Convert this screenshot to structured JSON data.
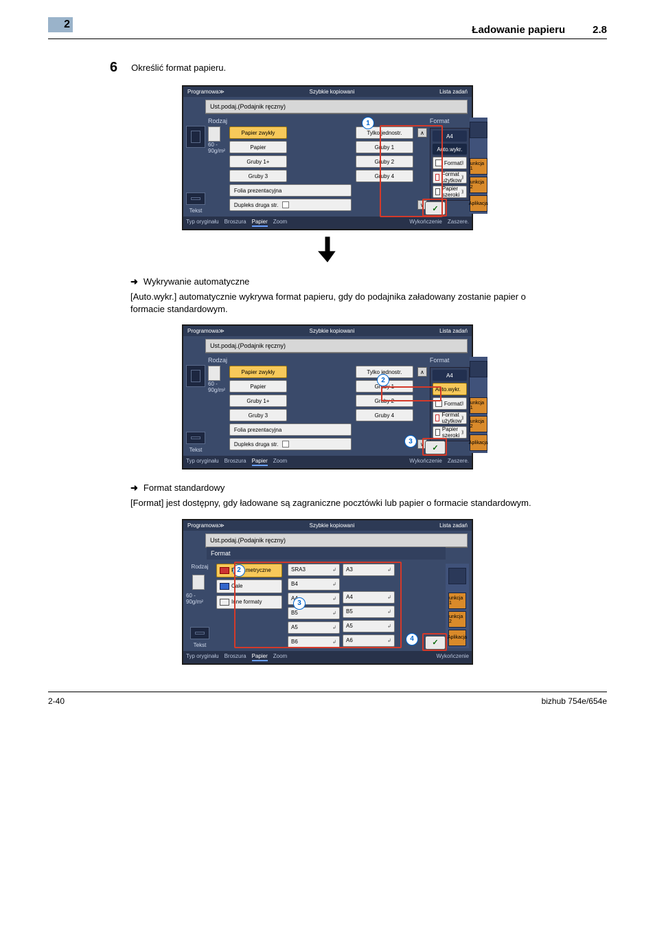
{
  "header": {
    "tab": "2",
    "title": "Ładowanie papieru",
    "section": "2.8"
  },
  "step": {
    "number": "6",
    "text": "Określić format papieru."
  },
  "sections": {
    "auto": {
      "heading": "Wykrywanie automatyczne",
      "desc": "[Auto.wykr.] automatycznie wykrywa format papieru, gdy do podajnika załadowany zostanie papier o formacie standardowym."
    },
    "std": {
      "heading": "Format standardowy",
      "desc": "[Format] jest dostępny, gdy ładowane są zagraniczne pocztówki lub papier o formacie standardowym."
    }
  },
  "shot_common": {
    "topbar_left": "Programowa≫",
    "topbar_mid": "Szybkie kopiowani",
    "topbar_right": "Lista zadań",
    "breadcrumb": "Ust.podaj.(Podajnik ręczny)",
    "rodzaj": "Rodzaj",
    "weight": "60 - 90g/m²",
    "format": "Format",
    "a4": "A4",
    "auto": "Auto.wykr.",
    "fmt": "Format",
    "fmt_uz": "Format użytkow",
    "fmt_sz": "Papier szeroki",
    "tekst": "Tekst",
    "bottom": {
      "typ": "Typ oryginału",
      "bro": "Broszura",
      "pap": "Papier",
      "zoom": "Zoom",
      "wyk": "Wykończenie",
      "zasz": "Zaszere."
    },
    "side": {
      "f1": "unkcja 1",
      "f2": "unkcja 2",
      "apl": "Aplikacja"
    },
    "paper_types_left": [
      "Papier zwykły",
      "Papier",
      "Gruby 1+",
      "Gruby 3",
      "Folia prezentacyjna",
      "Dupleks druga str."
    ],
    "paper_types_right": [
      "Tylko jednostr.",
      "Gruby 1",
      "Gruby 2",
      "Gruby 4"
    ]
  },
  "shot3": {
    "subhdr": "Format",
    "cats": [
      "Form.metryczne",
      "Cale",
      "Inne formaty"
    ],
    "col1": [
      "SRA3",
      "B4",
      "A4",
      "B5",
      "A5",
      "B6"
    ],
    "col2": [
      "A3",
      "",
      "A4",
      "B5",
      "A5",
      "A6"
    ]
  },
  "footer": {
    "left": "2-40",
    "right": "bizhub 754e/654e"
  }
}
